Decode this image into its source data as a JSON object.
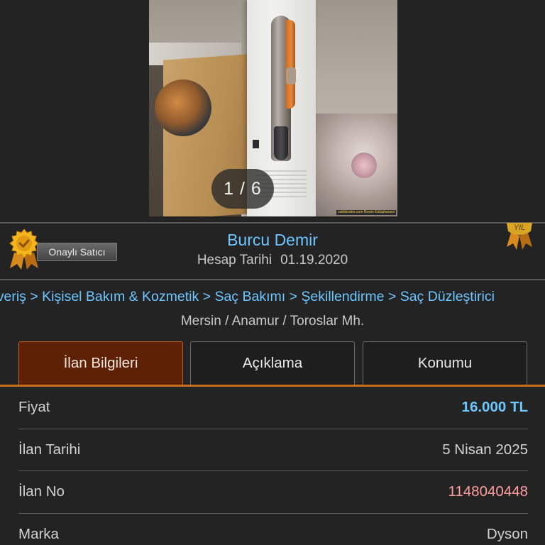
{
  "gallery": {
    "counter": "1 / 6",
    "watermark": "sahibinden.com Resim Kütüphanesi"
  },
  "seller": {
    "badge_label": "Onaylı Satıcı",
    "name": "Burcu Demir",
    "account_date_label": "Hesap Tarihi",
    "account_date_value": "01.19.2020",
    "year_badge_text": "YIL"
  },
  "category": {
    "breadcrumb": [
      "şveriş",
      "Kişisel Bakım & Kozmetik",
      "Saç Bakımı",
      "Şekillendirme",
      "Saç Düzleştirici"
    ],
    "separator": ">"
  },
  "location": "Mersin / Anamur / Toroslar Mh.",
  "tabs": [
    {
      "label": "İlan Bilgileri",
      "active": true
    },
    {
      "label": "Açıklama",
      "active": false
    },
    {
      "label": "Konumu",
      "active": false
    }
  ],
  "details": [
    {
      "label": "Fiyat",
      "value": "16.000 TL"
    },
    {
      "label": "İlan Tarihi",
      "value": "5 Nisan 2025"
    },
    {
      "label": "İlan No",
      "value": "1148040448"
    },
    {
      "label": "Marka",
      "value": "Dyson"
    }
  ],
  "colors": {
    "background": "#232323",
    "link": "#6ec6ff",
    "accent": "#c86f1e",
    "active_tab": "#5e2106",
    "listing_id": "#ff9e9e"
  }
}
